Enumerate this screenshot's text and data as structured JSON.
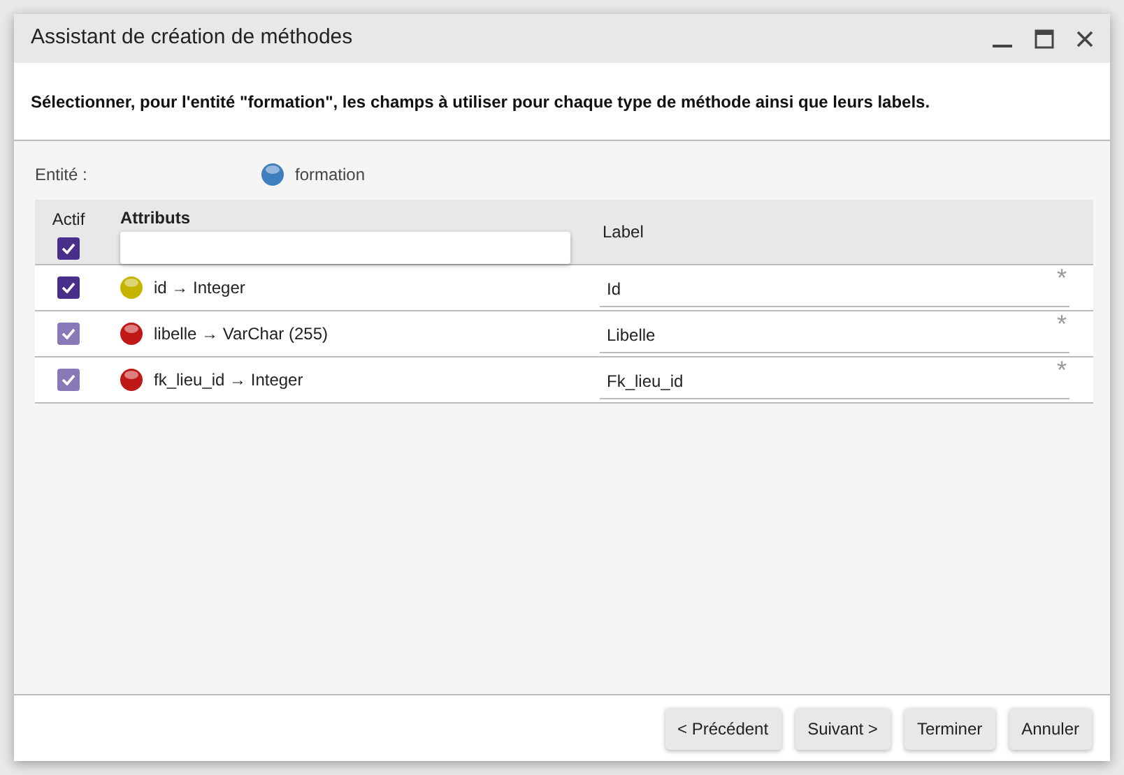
{
  "window": {
    "title": "Assistant de création de méthodes"
  },
  "description": "Sélectionner, pour l'entité \"formation\", les champs à utiliser pour chaque type de méthode ainsi que leurs labels.",
  "entity": {
    "label": "Entité :",
    "value": "formation",
    "color": "#3f7fc0"
  },
  "table": {
    "columns": [
      "Actif",
      "Attributs",
      "Label"
    ],
    "select_all_checked": true,
    "rows": [
      {
        "checked": true,
        "disabled": false,
        "color": "#c4b400",
        "attribute": "id → Integer",
        "label": "Id",
        "required_mark": "*"
      },
      {
        "checked": true,
        "disabled": true,
        "color": "#c01818",
        "attribute": "libelle → VarChar (255)",
        "label": "Libelle",
        "required_mark": "*"
      },
      {
        "checked": true,
        "disabled": true,
        "color": "#c01818",
        "attribute": "fk_lieu_id → Integer",
        "label": "Fk_lieu_id",
        "required_mark": "*"
      }
    ]
  },
  "buttons": [
    "< Précédent",
    "Suivant >",
    "Terminer",
    "Annuler"
  ]
}
